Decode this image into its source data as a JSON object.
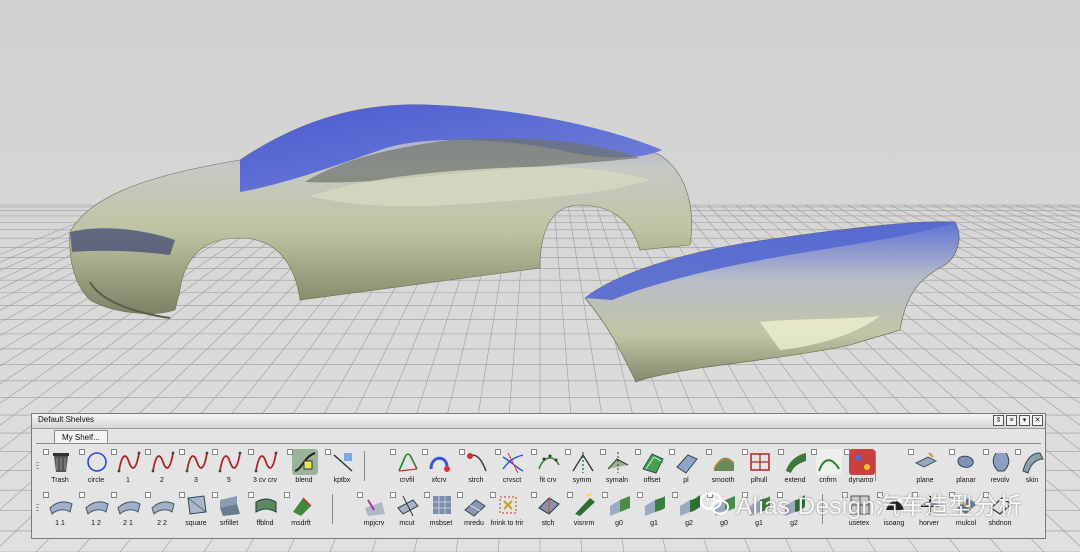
{
  "viewport": {
    "background_top": "#cfcfcf",
    "background_bottom": "#e2e2e2",
    "grid_color": "#9c9c9c",
    "body_colors": {
      "highlight": "#5a6fd8",
      "surface": "#c9ccb0",
      "shadow": "#6f7458"
    }
  },
  "shelf": {
    "title": "Default Shelves",
    "tab_label": "My Shelf...",
    "window_buttons": [
      "⇕",
      "≡",
      "▾",
      "✕"
    ],
    "row1": [
      {
        "label": "Trash",
        "icon": "trash-icon"
      },
      {
        "label": "circle",
        "icon": "circle-icon"
      },
      {
        "label": "1",
        "icon": "cv-curve-icon"
      },
      {
        "label": "2",
        "icon": "cv-curve-icon"
      },
      {
        "label": "3",
        "icon": "cv-curve-icon"
      },
      {
        "label": "5",
        "icon": "cv-curve-icon"
      },
      {
        "label": "3 cv crv",
        "icon": "cv-curve-icon"
      },
      {
        "label": "blend",
        "icon": "blend-icon"
      },
      {
        "label": "kptbx",
        "icon": "keypoint-icon"
      },
      {
        "label": "crvfil",
        "icon": "curve-fillet-icon"
      },
      {
        "label": "xfcrv",
        "icon": "xform-curve-icon"
      },
      {
        "label": "strch",
        "icon": "stretch-icon"
      },
      {
        "label": "crvsct",
        "icon": "curve-section-icon"
      },
      {
        "label": "fit crv",
        "icon": "fit-curve-icon"
      },
      {
        "label": "symm",
        "icon": "symmetry-icon"
      },
      {
        "label": "symaln",
        "icon": "symmetry-align-icon"
      },
      {
        "label": "offset",
        "icon": "offset-icon"
      },
      {
        "label": "pl",
        "icon": "panel-icon"
      },
      {
        "label": "smooth",
        "icon": "smooth-icon"
      },
      {
        "label": "plhull",
        "icon": "hull-icon"
      },
      {
        "label": "extend",
        "icon": "extend-icon"
      },
      {
        "label": "cnfrm",
        "icon": "conform-icon"
      },
      {
        "label": "dynamo",
        "icon": "dynamo-icon"
      },
      {
        "label": "plane",
        "icon": "plane-icon"
      },
      {
        "label": "planar",
        "icon": "planar-icon"
      },
      {
        "label": "revolv",
        "icon": "revolve-icon"
      },
      {
        "label": "skin",
        "icon": "skin-icon"
      }
    ],
    "row2": [
      {
        "label": "1 1",
        "icon": "surface-icon"
      },
      {
        "label": "1 2",
        "icon": "surface-icon"
      },
      {
        "label": "2 1",
        "icon": "surface-icon"
      },
      {
        "label": "2 2",
        "icon": "surface-icon"
      },
      {
        "label": "square",
        "icon": "square-surface-icon"
      },
      {
        "label": "srfillet",
        "icon": "surface-fillet-icon"
      },
      {
        "label": "ffblnd",
        "icon": "freeform-blend-icon"
      },
      {
        "label": "msdrft",
        "icon": "draft-icon"
      },
      {
        "label": "mpjcrv",
        "icon": "project-curve-icon"
      },
      {
        "label": "mcut",
        "icon": "cut-icon"
      },
      {
        "label": "msbset",
        "icon": "subset-icon"
      },
      {
        "label": "mredu",
        "icon": "reduce-icon"
      },
      {
        "label": "hrink to trir",
        "icon": "shrink-trim-icon"
      },
      {
        "label": "stch",
        "icon": "stitch-icon"
      },
      {
        "label": "visnrm",
        "icon": "visual-normal-icon"
      },
      {
        "label": "g0",
        "icon": "align-g0-icon"
      },
      {
        "label": "g1",
        "icon": "align-g1-icon"
      },
      {
        "label": "g2",
        "icon": "align-g2-icon"
      },
      {
        "label": "g0",
        "icon": "align-g0-icon"
      },
      {
        "label": "g1",
        "icon": "align-g1-icon"
      },
      {
        "label": "g2",
        "icon": "align-g2-icon"
      },
      {
        "label": "usetex",
        "icon": "use-texture-icon"
      },
      {
        "label": "isoang",
        "icon": "isoangle-icon"
      },
      {
        "label": "horver",
        "icon": "horizontal-vertical-icon"
      },
      {
        "label": "mulcol",
        "icon": "multicolor-icon"
      },
      {
        "label": "shdnon",
        "icon": "shade-none-icon"
      }
    ]
  },
  "watermark": {
    "text": "Alias Design汽车造型分析",
    "icon": "wechat-icon"
  }
}
